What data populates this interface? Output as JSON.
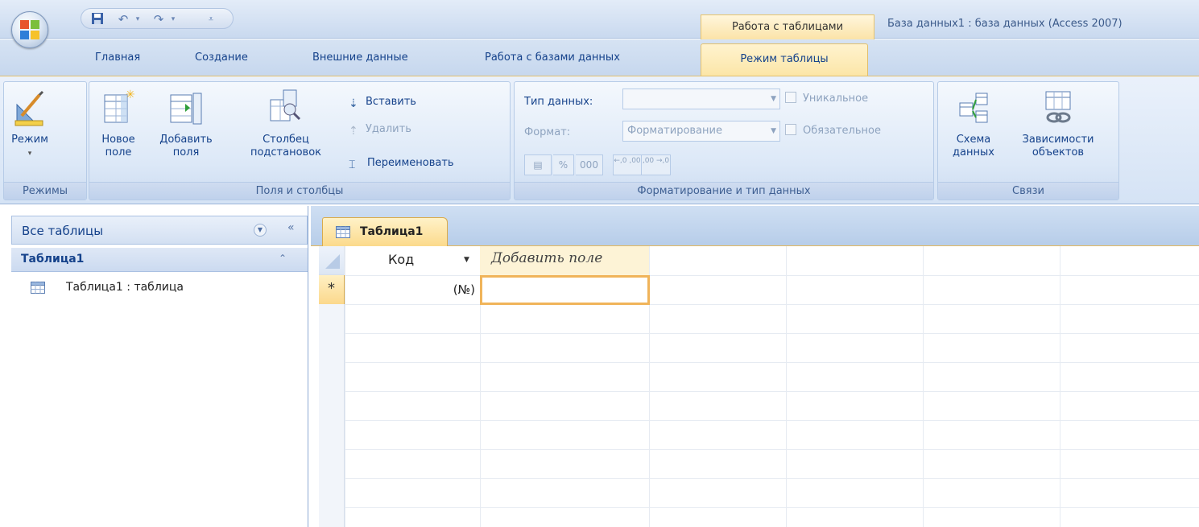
{
  "title_bar": {
    "app_title": "База данных1 : база данных (Access 2007)",
    "contextual_group": "Работа с таблицами",
    "quick_access": [
      "save-icon",
      "undo-icon",
      "redo-icon",
      "customize-icon"
    ]
  },
  "tabs": [
    {
      "label": "Главная"
    },
    {
      "label": "Создание"
    },
    {
      "label": "Внешние данные"
    },
    {
      "label": "Работа с базами данных"
    },
    {
      "label": "Режим таблицы",
      "active": true
    }
  ],
  "ribbon": {
    "modes": {
      "label": "Режимы",
      "mode_button": "Режим"
    },
    "fields": {
      "label": "Поля и столбцы",
      "new_field_1": "Новое",
      "new_field_2": "поле",
      "add_fields_1": "Добавить",
      "add_fields_2": "поля",
      "lookup_1": "Столбец",
      "lookup_2": "подстановок",
      "insert": "Вставить",
      "delete": "Удалить",
      "rename": "Переименовать"
    },
    "formatting": {
      "label": "Форматирование и тип данных",
      "data_type_label": "Тип данных:",
      "data_type_value": "",
      "format_label": "Формат:",
      "format_value": "Форматирование",
      "unique": "Уникальное",
      "required": "Обязательное",
      "percent": "%",
      "thousands": "000",
      "inc_decimals": "←,0 ,00",
      "dec_decimals": ",00 →,0"
    },
    "relationships": {
      "label": "Связи",
      "schema_1": "Схема",
      "schema_2": "данных",
      "deps_1": "Зависимости",
      "deps_2": "объектов"
    }
  },
  "nav_pane": {
    "header": "Все таблицы",
    "group": "Таблица1",
    "items": [
      {
        "label": "Таблица1 : таблица"
      }
    ]
  },
  "document": {
    "tab_label": "Таблица1",
    "columns": [
      "Код",
      "Добавить поле"
    ],
    "new_row_marker": "*",
    "new_row_value": "(№)"
  },
  "colors": {
    "accent": "#fbd98a",
    "ribbon_text": "#15428b",
    "selection_border": "#f0b45a"
  }
}
